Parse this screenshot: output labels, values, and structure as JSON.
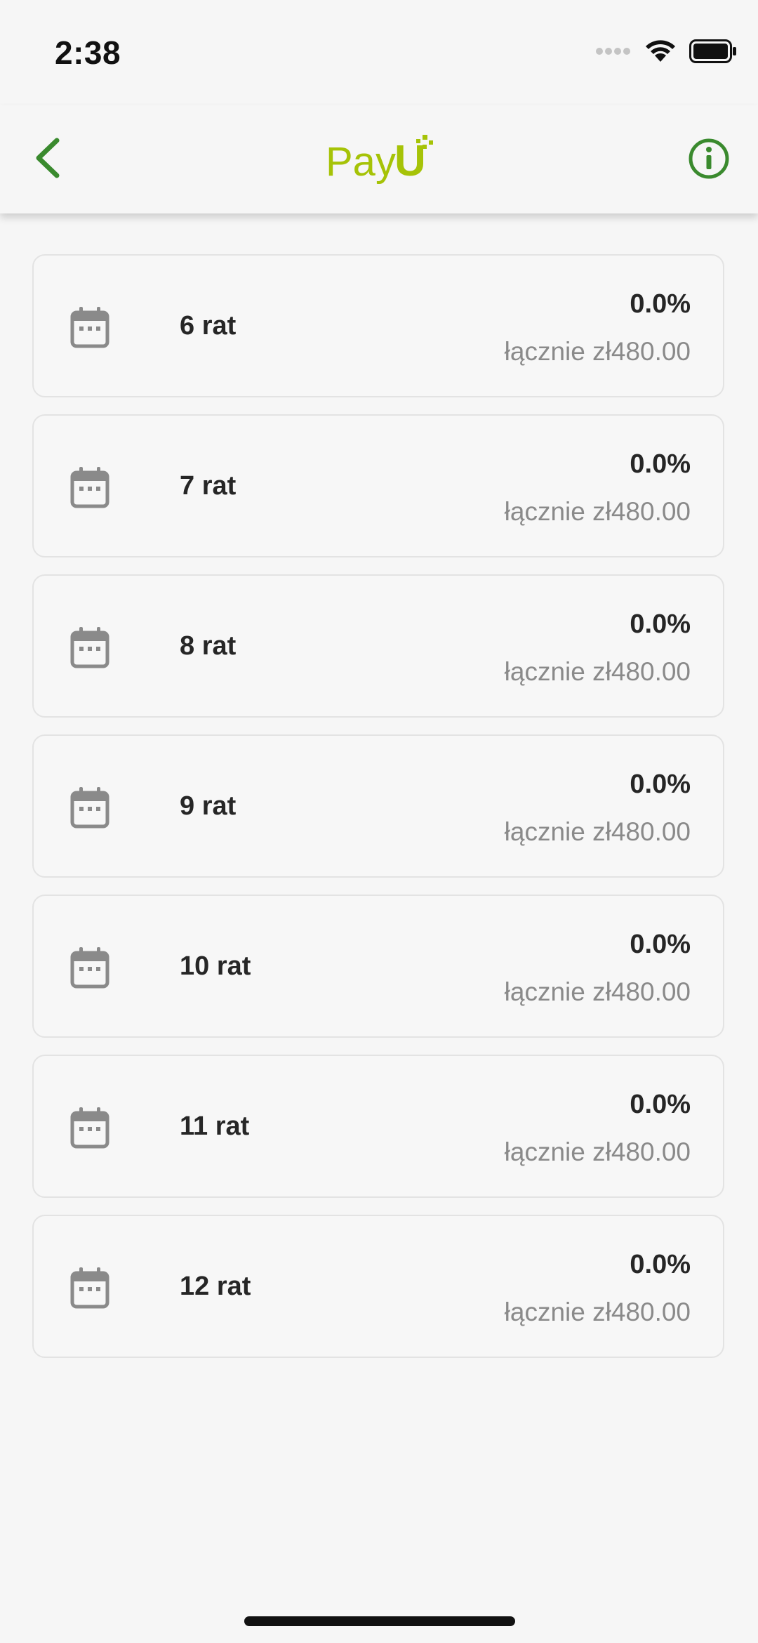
{
  "status_bar": {
    "time": "2:38",
    "icons": [
      "cellular-icon",
      "wifi-icon",
      "battery-icon"
    ]
  },
  "header": {
    "back_icon": "chevron-left-icon",
    "logo_text": "PayU",
    "info_icon": "info-icon"
  },
  "colors": {
    "accent": "#3a8a2e",
    "logo_green": "#a6c307",
    "background": "#f6f6f6",
    "card_border": "#e3e3e3",
    "icon_gray": "#8a8a8a"
  },
  "installments": [
    {
      "label": "6 rat",
      "rate": "0.0%",
      "total": "łącznie zł480.00"
    },
    {
      "label": "7 rat",
      "rate": "0.0%",
      "total": "łącznie zł480.00"
    },
    {
      "label": "8 rat",
      "rate": "0.0%",
      "total": "łącznie zł480.00"
    },
    {
      "label": "9 rat",
      "rate": "0.0%",
      "total": "łącznie zł480.00"
    },
    {
      "label": "10 rat",
      "rate": "0.0%",
      "total": "łącznie zł480.00"
    },
    {
      "label": "11 rat",
      "rate": "0.0%",
      "total": "łącznie zł480.00"
    },
    {
      "label": "12 rat",
      "rate": "0.0%",
      "total": "łącznie zł480.00"
    }
  ]
}
